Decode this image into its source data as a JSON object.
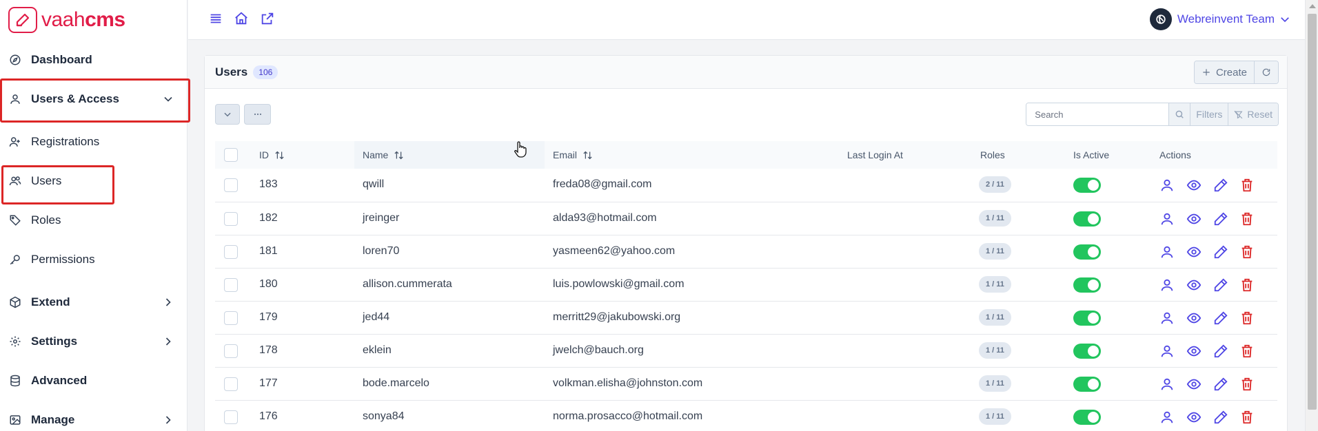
{
  "brand": {
    "part1": "vaah",
    "part2": "cms"
  },
  "sidebar": {
    "items": [
      {
        "label": "Dashboard",
        "icon": "compass-icon"
      },
      {
        "label": "Users & Access",
        "icon": "user-icon"
      },
      {
        "label": "Registrations",
        "icon": "user-plus-icon"
      },
      {
        "label": "Users",
        "icon": "users-icon"
      },
      {
        "label": "Roles",
        "icon": "tag-icon"
      },
      {
        "label": "Permissions",
        "icon": "key-icon"
      },
      {
        "label": "Extend",
        "icon": "box-icon"
      },
      {
        "label": "Settings",
        "icon": "gear-icon"
      },
      {
        "label": "Advanced",
        "icon": "database-icon"
      },
      {
        "label": "Manage",
        "icon": "image-icon"
      }
    ]
  },
  "topbar": {
    "team_name": "Webreinvent Team"
  },
  "panel": {
    "title": "Users",
    "count": "106",
    "create_label": "Create",
    "search_placeholder": "Search",
    "filters_label": "Filters",
    "reset_label": "Reset"
  },
  "table": {
    "columns": [
      "ID",
      "Name",
      "Email",
      "Last Login At",
      "Roles",
      "Is Active",
      "Actions"
    ],
    "rows": [
      {
        "id": "183",
        "name": "qwill",
        "email": "freda08@gmail.com",
        "roles": "2 / 11"
      },
      {
        "id": "182",
        "name": "jreinger",
        "email": "alda93@hotmail.com",
        "roles": "1 / 11"
      },
      {
        "id": "181",
        "name": "loren70",
        "email": "yasmeen62@yahoo.com",
        "roles": "1 / 11"
      },
      {
        "id": "180",
        "name": "allison.cummerata",
        "email": "luis.powlowski@gmail.com",
        "roles": "1 / 11"
      },
      {
        "id": "179",
        "name": "jed44",
        "email": "merritt29@jakubowski.org",
        "roles": "1 / 11"
      },
      {
        "id": "178",
        "name": "eklein",
        "email": "jwelch@bauch.org",
        "roles": "1 / 11"
      },
      {
        "id": "177",
        "name": "bode.marcelo",
        "email": "volkman.elisha@johnston.com",
        "roles": "1 / 11"
      },
      {
        "id": "176",
        "name": "sonya84",
        "email": "norma.prosacco@hotmail.com",
        "roles": "1 / 11"
      }
    ]
  },
  "colors": {
    "brand": "#e11d48",
    "accent": "#4f46e5",
    "active": "#22c55e",
    "danger": "#dc2626"
  }
}
